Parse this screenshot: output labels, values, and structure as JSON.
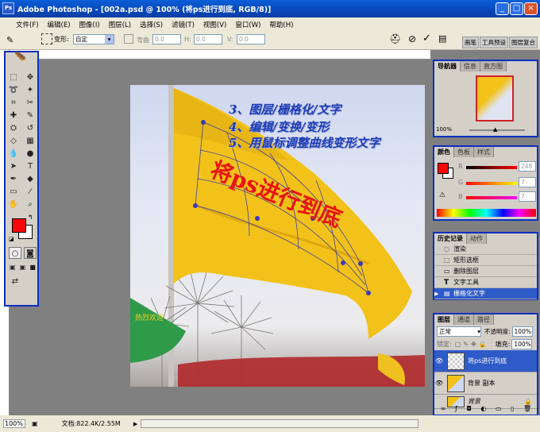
{
  "window": {
    "title": "Adobe Photoshop - [002a.psd @ 100% (将ps进行到底, RGB/8)]",
    "logo": "Ps"
  },
  "menu": [
    "文件(F)",
    "编辑(E)",
    "图像(I)",
    "图层(L)",
    "选择(S)",
    "滤镜(T)",
    "视图(V)",
    "窗口(W)",
    "帮助(H)"
  ],
  "options": {
    "transform_label": "变形:",
    "transform_value": "自定",
    "bend_label": "弯曲",
    "bend_value": "0.0",
    "h_label": "H:",
    "h_value": "0.0",
    "v_label": "V:",
    "v_value": "0.0",
    "dock_tabs": [
      "画笔",
      "工具预设",
      "图层复合"
    ]
  },
  "document": {
    "annotations": [
      "3、图层/栅格化/文字",
      "4、编辑/变换/变形",
      "5、用鼠标调整曲线变形文字"
    ],
    "flag_text": "将ps进行到底",
    "small_flag_text": "热烈欢迎"
  },
  "navigator": {
    "tabs": [
      "导航器",
      "信息",
      "直方图"
    ],
    "zoom": "100%"
  },
  "color": {
    "tabs": [
      "颜色",
      "色板",
      "样式"
    ],
    "channels": [
      {
        "label": "R",
        "value": "248"
      },
      {
        "label": "G",
        "value": "7"
      },
      {
        "label": "B",
        "value": "7"
      }
    ],
    "fg": "#f80707"
  },
  "history": {
    "tabs": [
      "历史记录",
      "动作"
    ],
    "items": [
      "渲染",
      "矩形选框",
      "删除图层",
      "文字工具",
      "栅格化文字"
    ],
    "active": 4
  },
  "layers": {
    "tabs": [
      "图层",
      "通道",
      "路径"
    ],
    "mode": "正常",
    "opacity_label": "不透明度:",
    "opacity": "100%",
    "lock_label": "锁定:",
    "fill_label": "填充:",
    "fill": "100%",
    "items": [
      {
        "name": "将ps进行到底",
        "selected": true
      },
      {
        "name": "背景 副本",
        "selected": false
      },
      {
        "name": "背景",
        "selected": false
      }
    ]
  },
  "status": {
    "zoom": "100%",
    "doc": "文档:822.4K/2.55M"
  }
}
